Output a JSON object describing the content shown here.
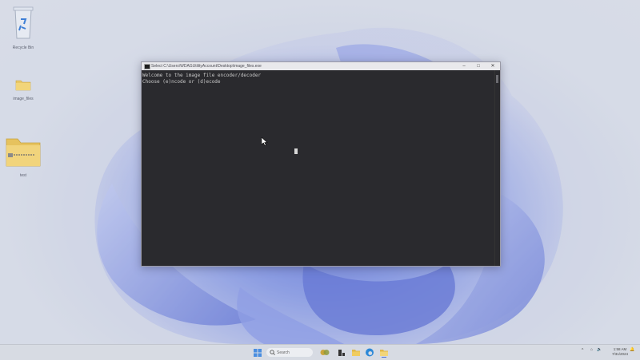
{
  "desktop": {
    "icons": [
      {
        "label": "Recycle Bin",
        "icon": "recycle-bin-icon"
      },
      {
        "label": "image_files",
        "icon": "folder-icon"
      },
      {
        "label": "test",
        "icon": "zip-folder-icon"
      }
    ]
  },
  "window": {
    "title": "Select C:\\Users\\WDAGUtilityAccount\\Desktop\\image_files.exe",
    "icon": "console-icon",
    "controls": {
      "minimize": "–",
      "maximize": "□",
      "close": "✕"
    }
  },
  "console": {
    "lines": [
      "Welcome to the image file encoder/decoder",
      "Choose (e)ncode or (d)ecode"
    ]
  },
  "taskbar": {
    "search_placeholder": "Search",
    "apps": [
      "start-icon",
      "search-icon",
      "task-view-icon",
      "file-explorer-icon",
      "edge-icon",
      "folder-icon"
    ],
    "tray": {
      "chevron": "^",
      "volume": "🔈",
      "network": "⌂",
      "time": "1:58 AM",
      "date": "7/31/2024",
      "bell": "🔔"
    }
  },
  "colors": {
    "console_bg": "#2a2a2e",
    "console_text": "#c8c8c8",
    "taskbar_bg": "#d7dbe3",
    "accent": "#4a5fd8"
  }
}
